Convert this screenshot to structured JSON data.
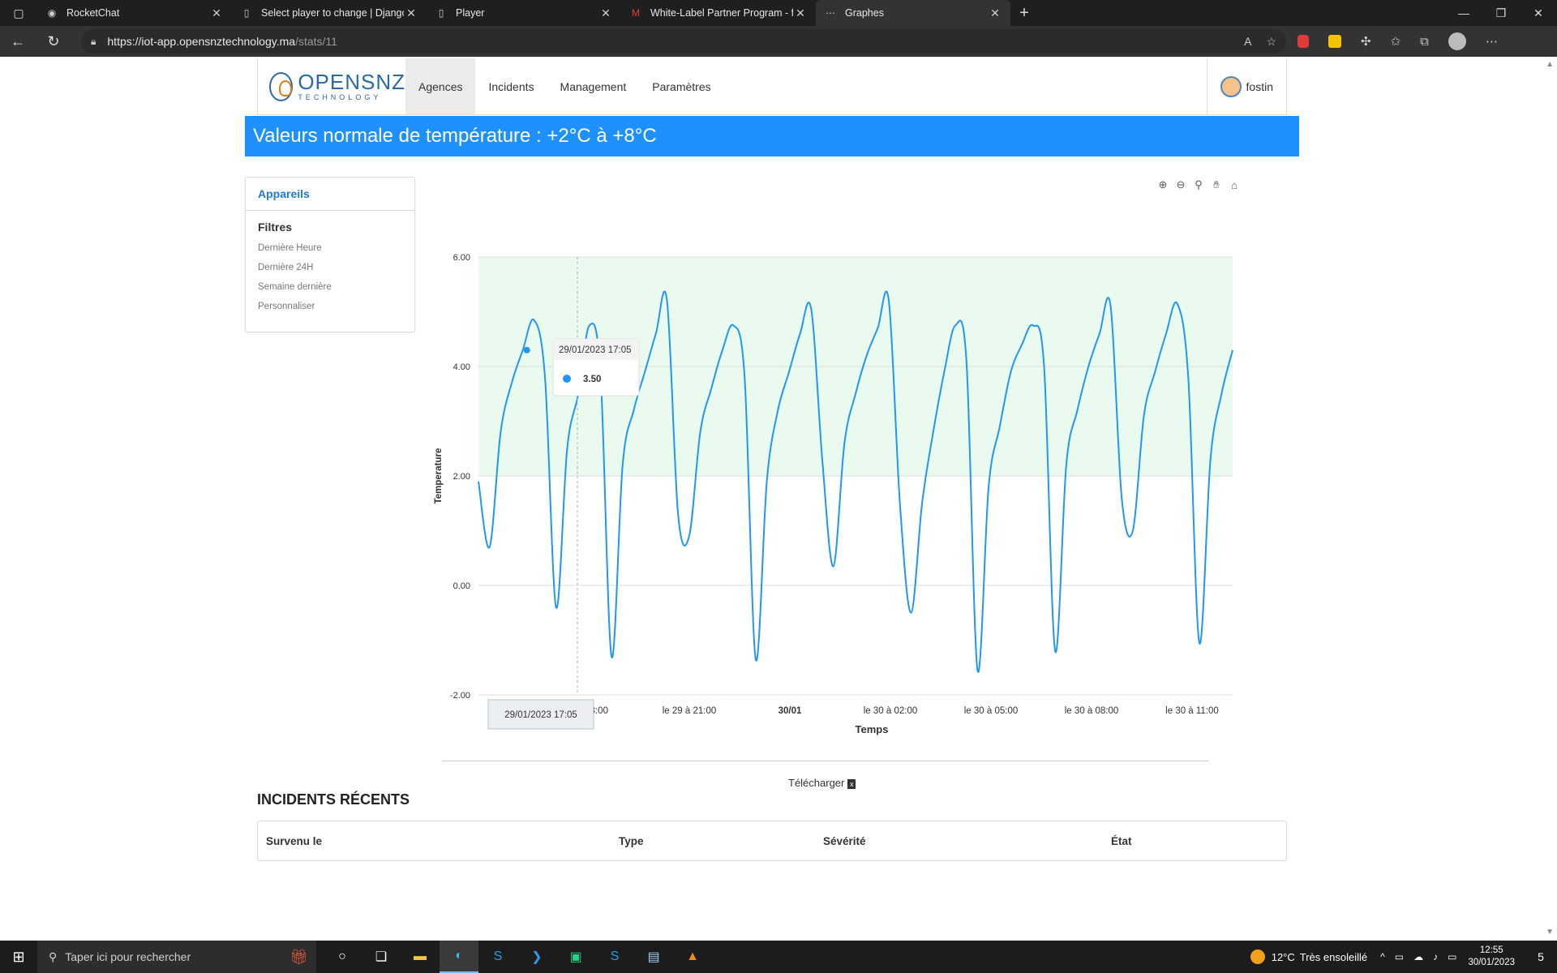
{
  "browser": {
    "tabs": [
      {
        "title": "RocketChat",
        "icon": "rocketchat-icon",
        "active": false
      },
      {
        "title": "Select player to change | Django",
        "icon": "page-icon",
        "active": false
      },
      {
        "title": "Player",
        "icon": "page-icon",
        "active": false
      },
      {
        "title": "White-Label Partner Program - fo",
        "icon": "gmail-icon",
        "active": false
      },
      {
        "title": "Graphes",
        "icon": "graph-icon",
        "active": true
      }
    ],
    "url_host": "https://iot-app.opensnztechnology.ma",
    "url_path": "/stats/11"
  },
  "brand": {
    "name": "OPENSNZ",
    "tagline": "TECHNOLOGY"
  },
  "nav": {
    "items": [
      "Agences",
      "Incidents",
      "Management",
      "Paramètres"
    ],
    "active": "Agences",
    "user": "fostin"
  },
  "banner": {
    "text": "Valeurs normale de température : +2°C à +8°C"
  },
  "sidebar": {
    "header": "Appareils",
    "filters_title": "Filtres",
    "filters": [
      "Dernière Heure",
      "Dernière 24H",
      "Semaine dernière",
      "Personnaliser"
    ]
  },
  "chart_data": {
    "type": "line",
    "ylabel": "Temperature",
    "xlabel": "Temps",
    "ylim": [
      -2,
      6
    ],
    "yticks": [
      "6.00",
      "4.00",
      "2.00",
      "0.00",
      "-2.00"
    ],
    "normal_band": [
      2,
      6
    ],
    "xticks": [
      "le 2",
      "9 à 18:00",
      "le 29 à 21:00",
      "30/01",
      "le 30 à 02:00",
      "le 30 à 05:00",
      "le 30 à 08:00",
      "le 30 à 11:00"
    ],
    "bold_tick": "30/01",
    "series": [
      {
        "color": "#2196f3",
        "values": [
          1.9,
          0.7,
          2.8,
          3.7,
          4.3,
          4.85,
          3.8,
          -0.4,
          2.5,
          3.5,
          4.75,
          3.9,
          -1.3,
          2.2,
          3.2,
          3.9,
          4.6,
          5.2,
          1.3,
          0.9,
          2.8,
          3.6,
          4.3,
          4.75,
          3.8,
          -1.35,
          1.9,
          3.2,
          3.9,
          4.6,
          5.05,
          2.3,
          0.35,
          2.6,
          3.5,
          4.2,
          4.7,
          5.2,
          1.5,
          -0.5,
          1.5,
          2.8,
          3.9,
          4.75,
          4.1,
          -1.55,
          1.8,
          2.9,
          3.9,
          4.4,
          4.75,
          4.0,
          -1.2,
          2.2,
          3.2,
          4.0,
          4.6,
          5.1,
          1.6,
          1.0,
          3.1,
          3.9,
          4.6,
          5.15,
          3.8,
          -1.05,
          2.3,
          3.5,
          4.3
        ]
      }
    ],
    "marker": {
      "value": 4.3
    },
    "tooltip": {
      "title": "29/01/2023 17:05",
      "value": "3.50"
    },
    "crosshair_label": "29/01/2023 17:05"
  },
  "download_label": "Télécharger",
  "incidents": {
    "title": "INCIDENTS RÉCENTS",
    "columns": [
      "Survenu le",
      "Type",
      "Sévérité",
      "État"
    ]
  },
  "taskbar": {
    "search_placeholder": "Taper ici pour rechercher",
    "weather_temp": "12°C",
    "weather_text": "Très ensoleillé",
    "time": "12:55",
    "date": "30/01/2023",
    "notif_count": "5"
  }
}
